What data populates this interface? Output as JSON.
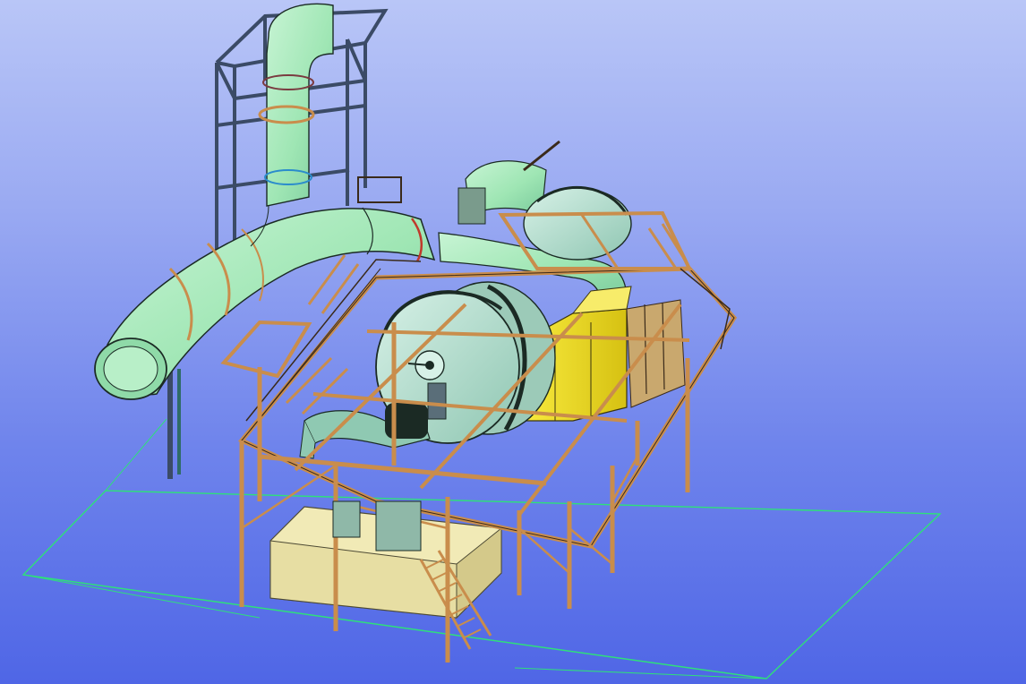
{
  "viewport": {
    "kind": "3d-cad-model-view",
    "background_top": "#b9c6f7",
    "background_bottom": "#4f66e6",
    "ground_grid_color": "#2ee07a"
  },
  "model": {
    "colors": {
      "duct": "#9fe6b4",
      "duct_outline": "#1b2a24",
      "steel_structure": "#c98d4c",
      "steel_outline": "#3a2a1a",
      "equipment_housing": "#f2dd22",
      "foundation": "#f1eab6",
      "fan_wheel": "#a9d6c6",
      "frame_tower": "#3b4b66"
    },
    "components": [
      "exhaust-duct",
      "fan-wheel",
      "support-tower",
      "platform-structure",
      "yellow-housing",
      "concrete-foundation",
      "stairs"
    ]
  }
}
